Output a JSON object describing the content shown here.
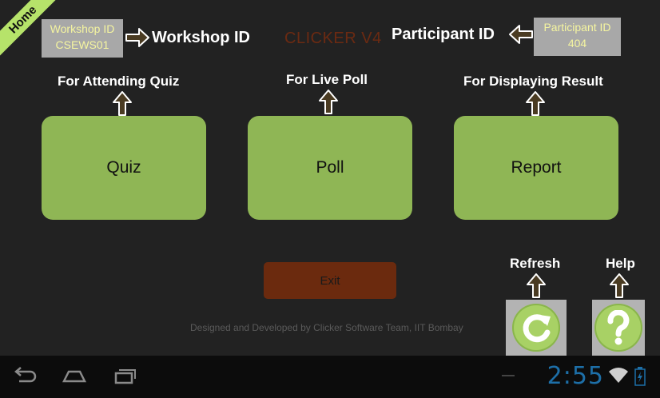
{
  "home_ribbon": "Home",
  "app_title": "CLICKER V4",
  "workshop": {
    "box_label": "Workshop ID",
    "box_value": "CSEWS01",
    "header_label": "Workshop ID"
  },
  "participant": {
    "box_label": "Participant ID",
    "box_value": "404",
    "header_label": "Participant ID"
  },
  "hints": {
    "quiz": "For Attending Quiz",
    "poll": "For Live Poll",
    "report": "For Displaying Result",
    "refresh": "Refresh",
    "help": "Help"
  },
  "buttons": {
    "quiz": "Quiz",
    "poll": "Poll",
    "report": "Report",
    "exit": "Exit"
  },
  "credit": "Designed and Developed by Clicker Software Team, IIT Bombay",
  "status_bar": {
    "time": "2:55"
  },
  "colors": {
    "accent_green": "#8fb655",
    "exit_brown": "#6b2a0e",
    "id_box_gray": "#a8a8a8",
    "title_brown": "#6b2a12",
    "clock_blue": "#1d6fa8"
  }
}
